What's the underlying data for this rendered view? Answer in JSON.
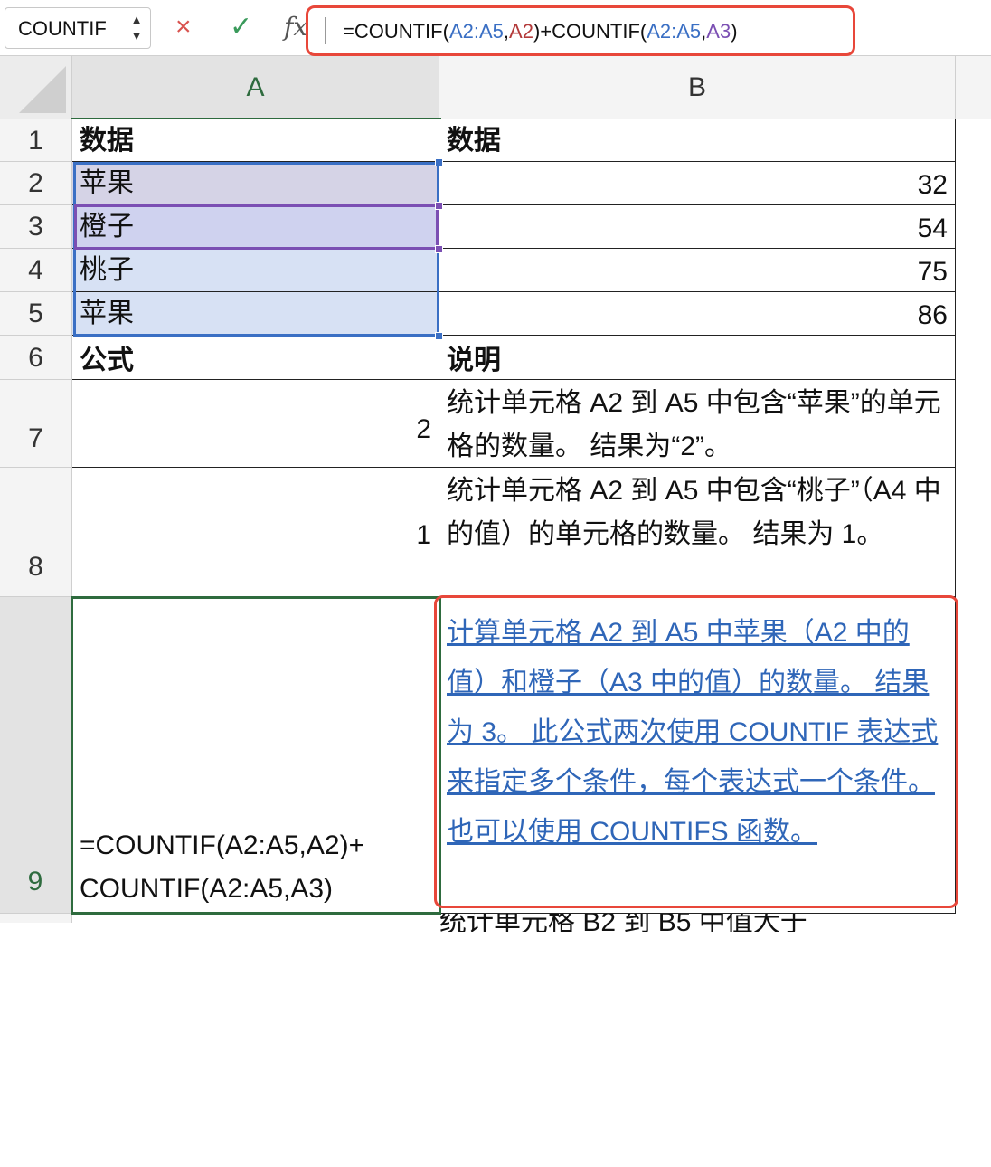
{
  "formula_bar": {
    "name_box": "COUNTIF",
    "cancel_icon": "×",
    "confirm_icon": "✓",
    "fx_label": "fx",
    "formula_parts": [
      {
        "text": "=COUNTIF(",
        "color": "plain"
      },
      {
        "text": "A2:A5",
        "color": "blue"
      },
      {
        "text": ",",
        "color": "plain"
      },
      {
        "text": "A2",
        "color": "red"
      },
      {
        "text": ")+COUNTIF(",
        "color": "plain"
      },
      {
        "text": "A2:A5",
        "color": "blue"
      },
      {
        "text": ",",
        "color": "plain"
      },
      {
        "text": "A3",
        "color": "purple"
      },
      {
        "text": ")",
        "color": "plain"
      }
    ]
  },
  "columns": [
    "A",
    "B"
  ],
  "rows": [
    "1",
    "2",
    "3",
    "4",
    "5",
    "6",
    "7",
    "8",
    "9"
  ],
  "cells": {
    "A1": "数据",
    "B1": "数据",
    "A2": "苹果",
    "B2": "32",
    "A3": "橙子",
    "B3": "54",
    "A4": "桃子",
    "B4": "75",
    "A5": "苹果",
    "B5": "86",
    "A6": "公式",
    "B6": "说明",
    "A7": "2",
    "B7": "统计单元格 A2 到 A5 中包含“苹果”的单元格的数量。 结果为“2”。",
    "A8": "1",
    "B8": "统计单元格 A2 到 A5 中包含“桃子”（A4 中的值）的单元格的数量。 结果为 1。",
    "A9": "=COUNTIF(A2:A5,A2)+ COUNTIF(A2:A5,A3)",
    "B9": "计算单元格 A2 到 A5 中苹果（A2 中的值）和橙子（A3 中的值）的数量。 结果为 3。 此公式两次使用 COUNTIF 表达式来指定多个条件，每个表达式一个条件。 也可以使用 COUNTIFS 函数。"
  },
  "partial_row_text": "统计单元格 B2 到 B5 中值大于"
}
